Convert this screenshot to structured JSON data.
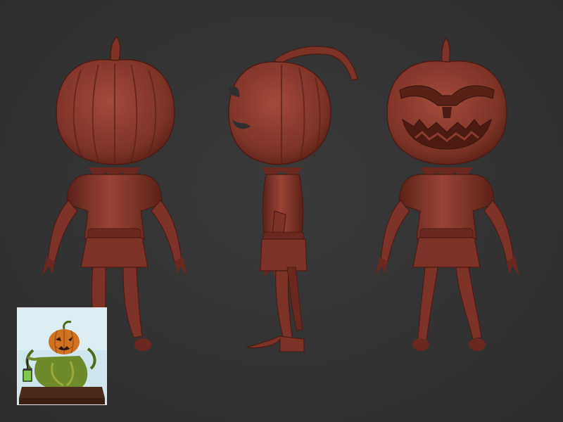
{
  "scene": {
    "background_color": "#333333",
    "model_color": "#8a3a2e",
    "model_shadow_color": "#5a2119",
    "model_highlight_color": "#b35a48"
  },
  "views": [
    {
      "id": "back",
      "label": ""
    },
    {
      "id": "side",
      "label": ""
    },
    {
      "id": "front",
      "label": ""
    }
  ],
  "reference_thumbnail": {
    "caption": "",
    "background_color": "#cfe6ee",
    "pumpkin_color": "#d0731e",
    "foliage_color": "#6f8a2a",
    "base_color": "#4a2a1a"
  }
}
